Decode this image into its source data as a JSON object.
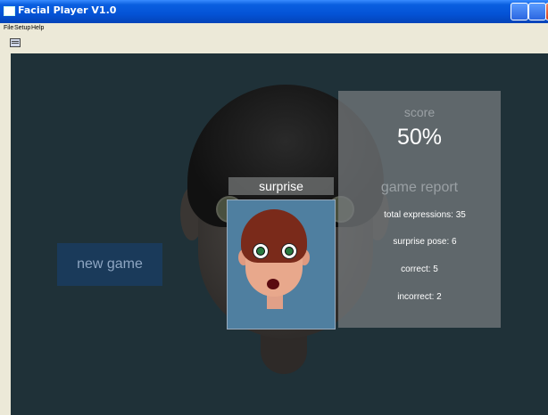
{
  "window": {
    "title": "Facial Player V1.0"
  },
  "menu": {
    "items": [
      "File",
      "Setup",
      "Help"
    ]
  },
  "game": {
    "expression_label": "surprise",
    "new_game_label": "new game"
  },
  "score": {
    "label": "score",
    "value": "50%"
  },
  "report": {
    "title": "game report",
    "total_expressions": "total expressions: 35",
    "surprise_pose": "surprise pose: 6",
    "correct": "correct: 5",
    "incorrect": "incorrect: 2"
  }
}
